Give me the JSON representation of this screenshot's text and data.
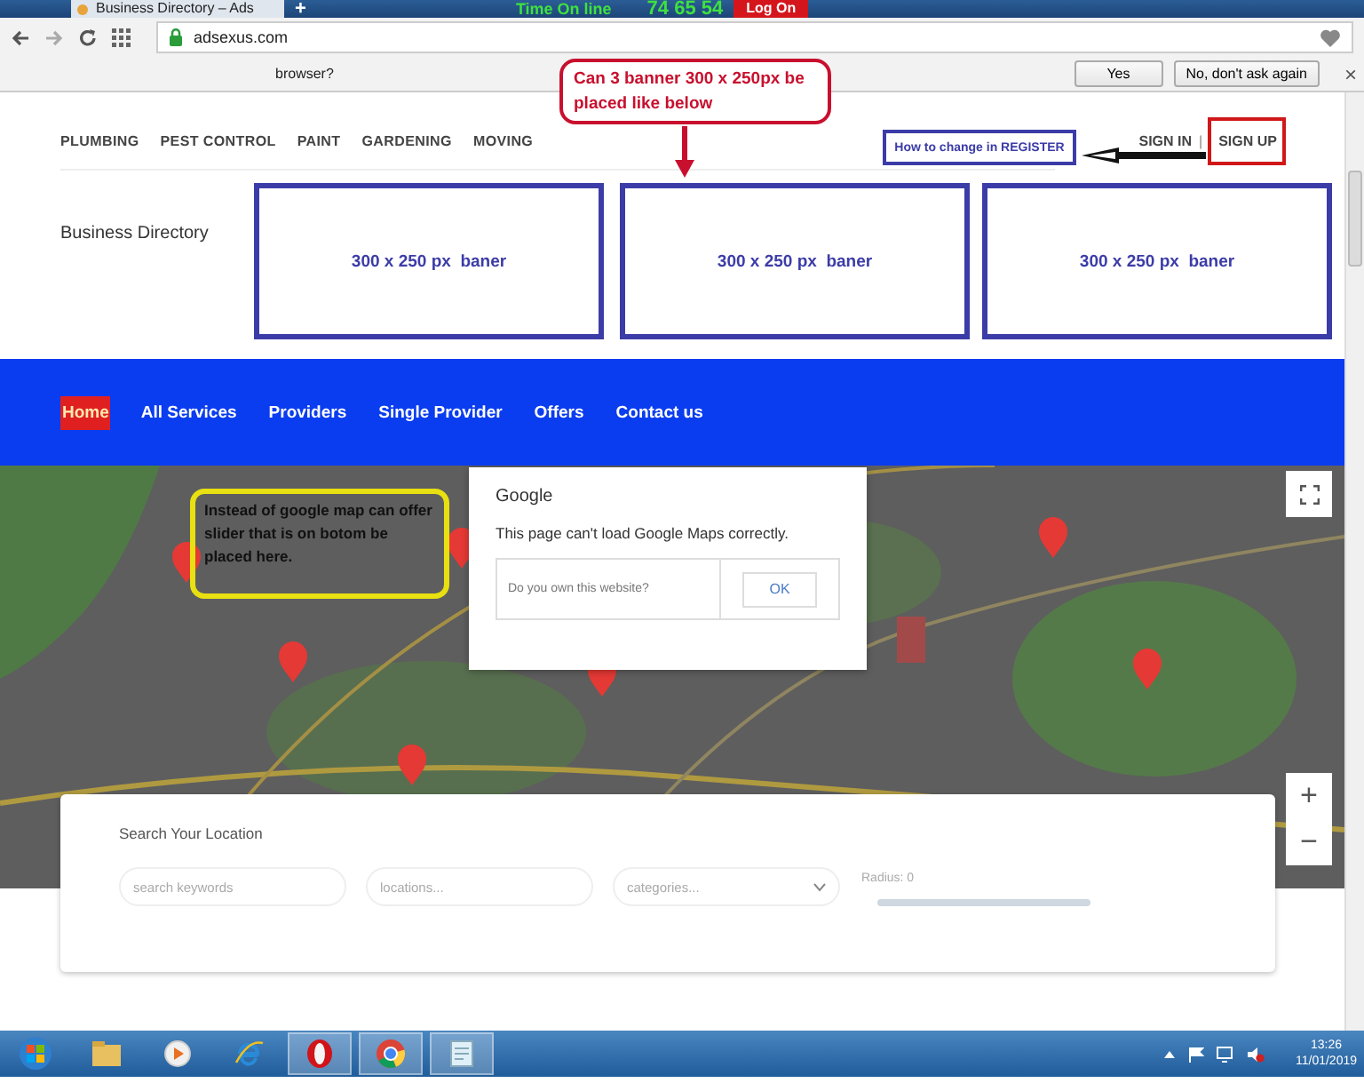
{
  "browser": {
    "tab_title": "Business Directory – Ads",
    "new_tab": "+",
    "timer": {
      "label": "Time On line",
      "value": "74 65 54",
      "button": "Log On"
    },
    "address": "adsexus.com",
    "infobar": {
      "message": "browser?",
      "buttons": [
        "Yes",
        "No, don't ask again"
      ],
      "close": "×"
    }
  },
  "page": {
    "categories": [
      "PLUMBING",
      "PEST CONTROL",
      "PAINT",
      "GARDENING",
      "MOVING"
    ],
    "auth": {
      "sign_in": "SIGN IN",
      "separator": "|",
      "sign_up": "SIGN UP"
    },
    "brand": "Business Directory",
    "nav": [
      {
        "label": "Home",
        "selected": true
      },
      {
        "label": "All Services",
        "selected": false
      },
      {
        "label": "Providers",
        "selected": false
      },
      {
        "label": "Single Provider",
        "selected": false
      },
      {
        "label": "Offers",
        "selected": false
      },
      {
        "label": "Contact us",
        "selected": false
      }
    ],
    "map": {
      "kind": "picture",
      "dialog": {
        "title": "Google",
        "message": "This page can't load Google Maps correctly.",
        "question": "Do you own this website?",
        "button": "OK"
      },
      "zoom_in": "+",
      "zoom_out": "−"
    },
    "search": {
      "title": "Search Your Location",
      "fields": [
        {
          "kind": "text",
          "placeholder": "search keywords"
        },
        {
          "kind": "text",
          "placeholder": "locations..."
        },
        {
          "kind": "select",
          "placeholder": "categories..."
        }
      ],
      "radius": {
        "label": "Radius: 0",
        "level": 0
      }
    }
  },
  "annotations": {
    "question": "Can 3 banner 300 x 250px be placed like below",
    "register_note": "How to change in REGISTER",
    "map_note": "Instead of google map can offer slider that is on botom be placed here.",
    "banners": [
      "300 x 250 px  baner",
      "300 x 250 px  baner",
      "300 x 250 px  baner"
    ]
  },
  "taskbar": {
    "time": "13:26",
    "date": "11/01/2019"
  }
}
